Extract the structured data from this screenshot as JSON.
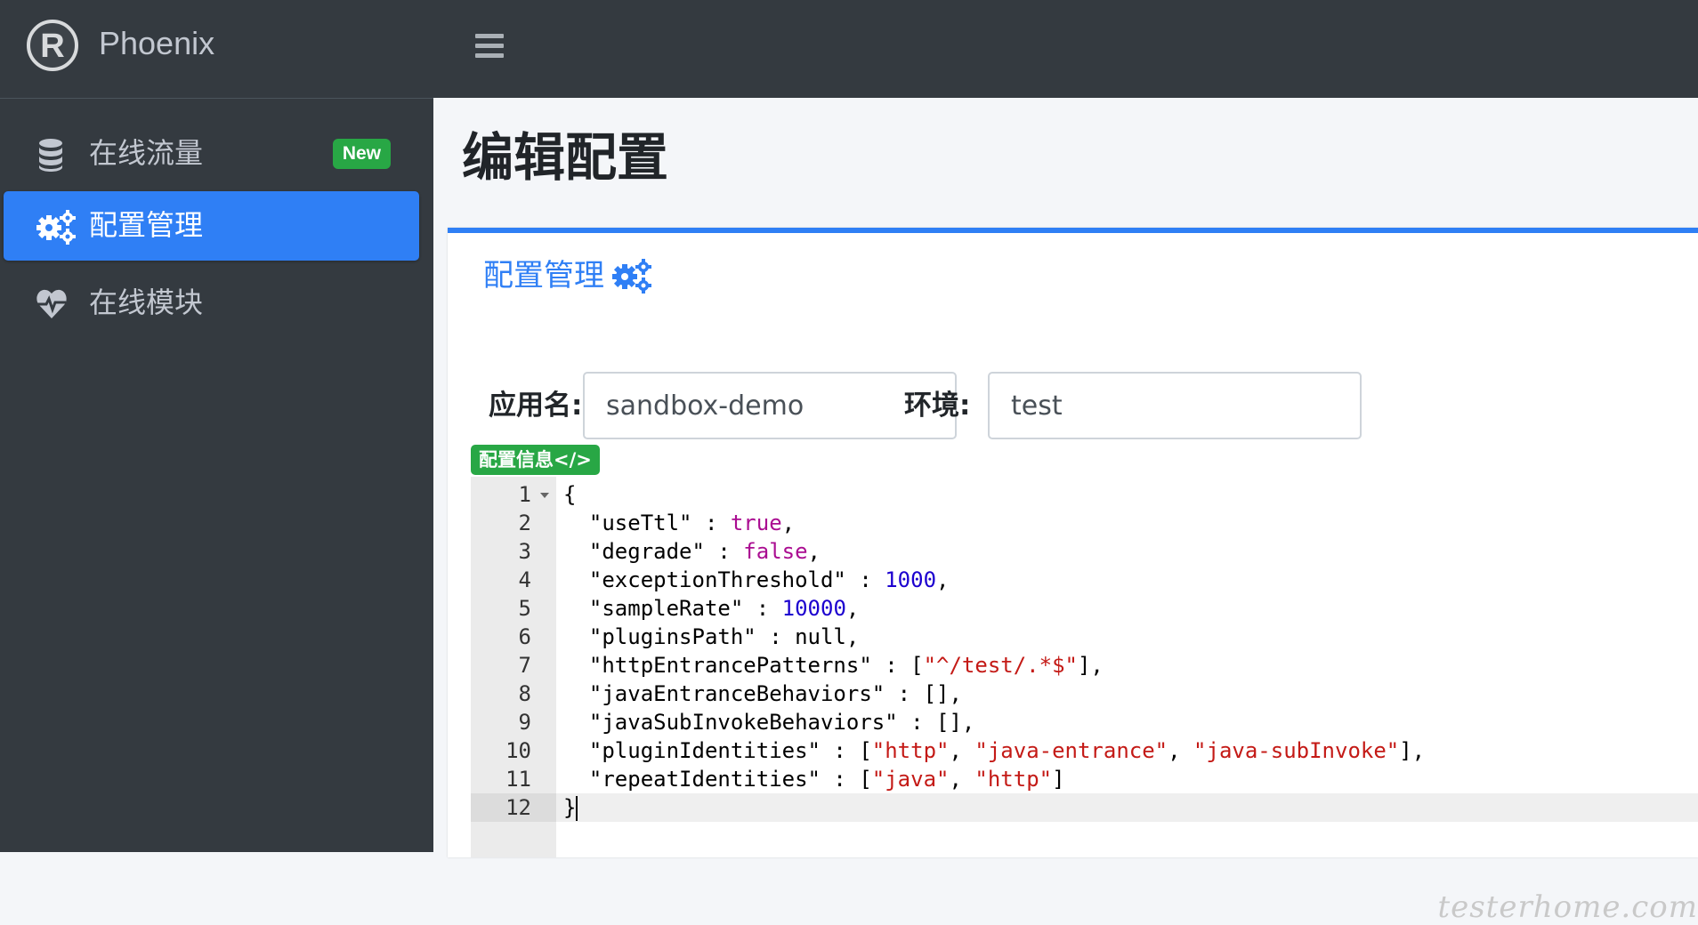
{
  "brand": {
    "logo_letter": "R",
    "name": "Phoenix"
  },
  "sidebar": {
    "items": [
      {
        "label": "在线流量",
        "icon": "database-icon",
        "badge": "New",
        "active": false
      },
      {
        "label": "配置管理",
        "icon": "cogs-icon",
        "active": true
      },
      {
        "label": "在线模块",
        "icon": "heartbeat-icon",
        "active": false
      }
    ]
  },
  "header": {
    "menu_icon": "hamburger-icon"
  },
  "page": {
    "title": "编辑配置"
  },
  "card": {
    "title": "配置管理",
    "title_icon": "cogs-icon",
    "app_label": "应用名:",
    "app_value": "sandbox-demo",
    "env_label": "环境:",
    "env_value": "test",
    "config_badge": "配置信息</>"
  },
  "editor": {
    "line_numbers": [
      "1",
      "2",
      "3",
      "4",
      "5",
      "6",
      "7",
      "8",
      "9",
      "10",
      "11",
      "12"
    ],
    "lines": [
      "{",
      "  \"useTtl\" : true,",
      "  \"degrade\" : false,",
      "  \"exceptionThreshold\" : 1000,",
      "  \"sampleRate\" : 10000,",
      "  \"pluginsPath\" : null,",
      "  \"httpEntrancePatterns\" : [\"^/test/.*$\"],",
      "  \"javaEntranceBehaviors\" : [],",
      "  \"javaSubInvokeBehaviors\" : [],",
      "  \"pluginIdentities\" : [\"http\", \"java-entrance\", \"java-subInvoke\"],",
      "  \"repeatIdentities\" : [\"java\", \"http\"]",
      "}"
    ],
    "current_line": 12
  },
  "watermark": "testerhome.com",
  "colors": {
    "sidebar_bg": "#343a40",
    "accent": "#2f7ff5",
    "badge_green": "#28a745",
    "string": "#c41a16",
    "number": "#1c00cf",
    "boolean": "#aa0d91"
  }
}
